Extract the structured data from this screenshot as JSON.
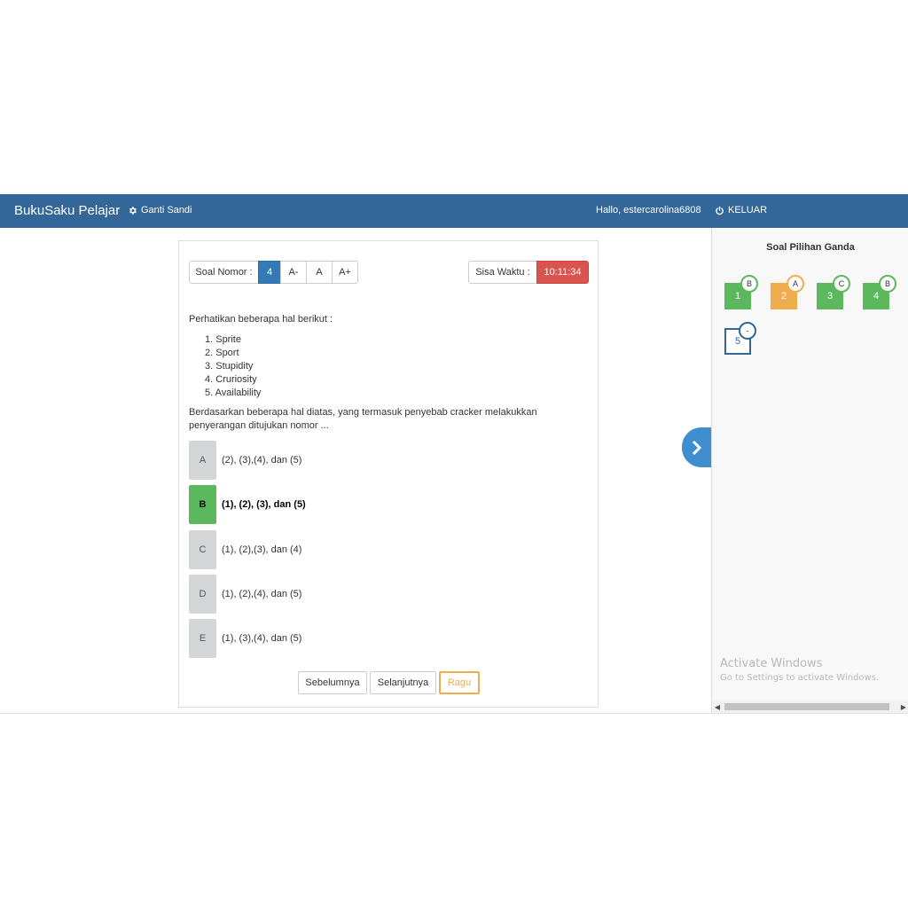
{
  "navbar": {
    "brand": "BukuSaku Pelajar",
    "settings_label": "Ganti Sandi",
    "greeting": "Hallo, estercarolina6808",
    "logout_label": "KELUAR"
  },
  "toolbar": {
    "number_label": "Soal Nomor :",
    "current_number": "4",
    "font_smaller": "A-",
    "font_normal": "A",
    "font_larger": "A+",
    "time_label": "Sisa Waktu :",
    "time_remaining": "10:11:34"
  },
  "question": {
    "intro": "Perhatikan beberapa hal berikut :",
    "items": [
      "1. Sprite",
      "2. Sport",
      "3. Stupidity",
      "4. Cruriosity",
      "5. Availability"
    ],
    "body": "Berdasarkan beberapa hal diatas, yang termasuk penyebab cracker melakukkan penyerangan ditujukan nomor ..."
  },
  "options": [
    {
      "key": "A",
      "text": "(2), (3),(4), dan (5)"
    },
    {
      "key": "B",
      "text": "(1), (2), (3), dan (5)"
    },
    {
      "key": "C",
      "text": "(1), (2),(3), dan (4)"
    },
    {
      "key": "D",
      "text": "(1), (2),(4), dan (5)"
    },
    {
      "key": "E",
      "text": "(1), (3),(4), dan (5)"
    }
  ],
  "selected_option": "B",
  "buttons": {
    "prev": "Sebelumnya",
    "next": "Selanjutnya",
    "doubt": "Ragu"
  },
  "sidebar": {
    "title": "Soal Pilihan Ganda",
    "questions": [
      {
        "number": "1",
        "answer": "B",
        "status": "answered"
      },
      {
        "number": "2",
        "answer": "A",
        "status": "doubt"
      },
      {
        "number": "3",
        "answer": "C",
        "status": "answered"
      },
      {
        "number": "4",
        "answer": "B",
        "status": "answered"
      },
      {
        "number": "5",
        "answer": "-",
        "status": "unanswered"
      }
    ]
  },
  "watermark": {
    "line1": "Activate Windows",
    "line2": "Go to Settings to activate Windows."
  },
  "colors": {
    "navbar": "#33679a",
    "primary": "#337ab7",
    "danger": "#d9534f",
    "success": "#5cb85c",
    "warning": "#f0ad4e"
  },
  "icons": {
    "settings": "gear-icon",
    "logout": "power-icon",
    "toggle": "chevron-right-icon"
  }
}
